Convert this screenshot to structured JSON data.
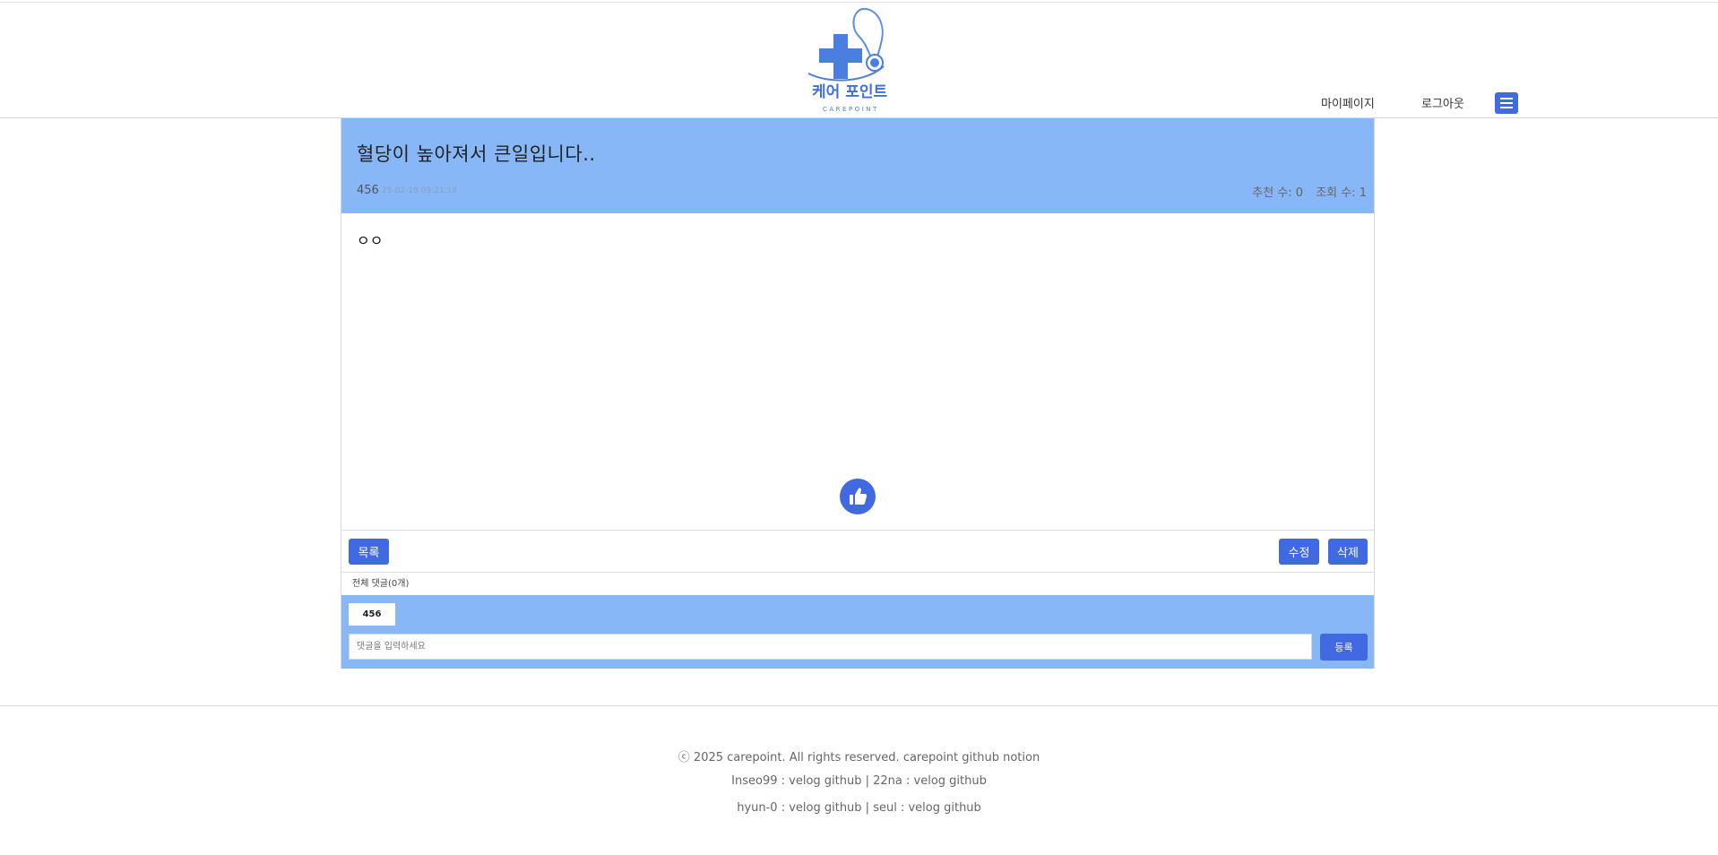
{
  "header": {
    "logo": {
      "text": "케어 포인트",
      "subtext": "CAREPOINT",
      "icon": "care-plus-stethoscope-logo"
    },
    "nav": {
      "mypage_label": "마이페이지",
      "logout_label": "로그아웃"
    },
    "menu_icon": "hamburger-icon"
  },
  "post": {
    "title": "혈당이 높아져서 큰일입니다..",
    "author": "456",
    "date": "25-02-19 09:21:18",
    "recommend_count": "추천 수: 0",
    "view_count": "조회 수: 1",
    "body": "ㅇㅇ",
    "like_icon": "thumbs-up-icon"
  },
  "actions": {
    "list_label": "목록",
    "edit_label": "수정",
    "delete_label": "삭제"
  },
  "comments": {
    "count_label": "전체 댓글(0개)",
    "current_user": "456",
    "input_placeholder": "댓글을 입력하세요",
    "submit_label": "등록"
  },
  "footer": {
    "line1": "ⓒ 2025 carepoint. All rights reserved. carepoint github notion",
    "line2": "Inseo99 : velog github | 22na : velog github",
    "line3": "hyun-0 : velog github | seul : velog github"
  },
  "colors": {
    "accent": "#4169e1",
    "header_band": "#87b7f7",
    "border": "#d9d9d9"
  }
}
